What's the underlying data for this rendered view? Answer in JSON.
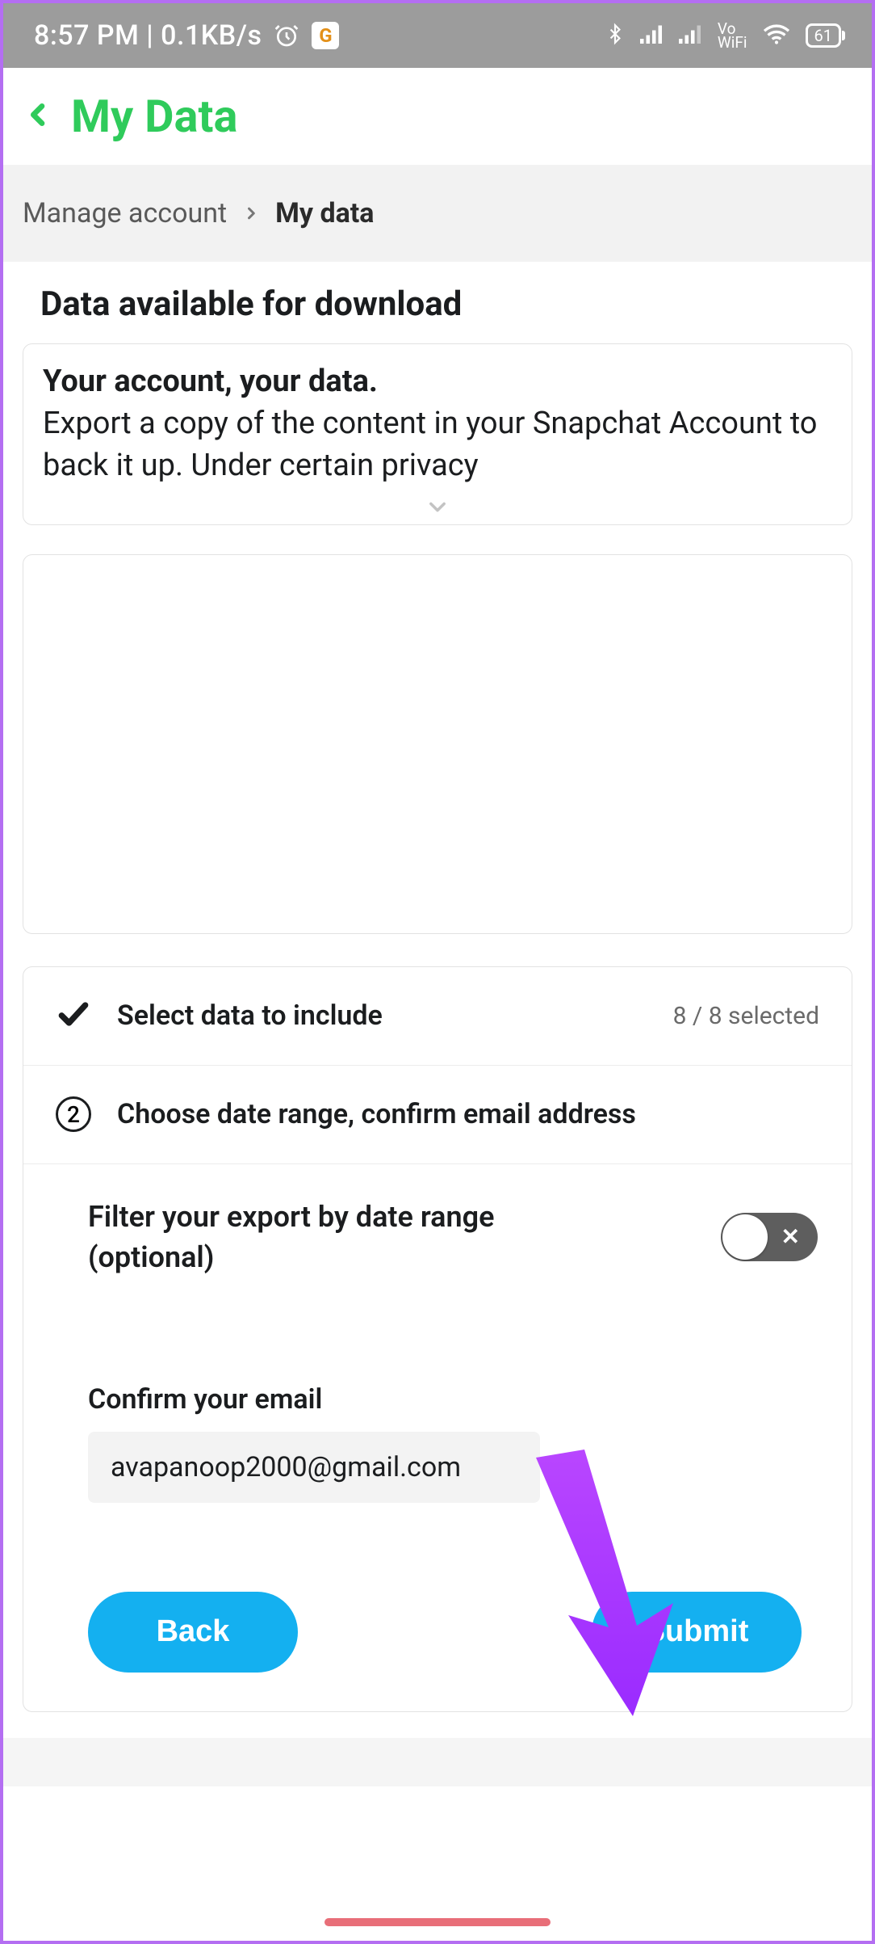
{
  "status": {
    "time_speed": "8:57 PM | 0.1KB/s",
    "vo_wifi_top": "Vo",
    "vo_wifi_bot": "WiFi",
    "battery": "61"
  },
  "title": "My Data",
  "breadcrumb": {
    "a": "Manage account",
    "b": "My data"
  },
  "section_heading": "Data available for download",
  "intro": {
    "title": "Your account, your data.",
    "body": "Export a copy of the content in your Snapchat Account to back it up. Under certain privacy"
  },
  "step1": {
    "title": "Select data to include",
    "count": "8 / 8 selected"
  },
  "step2": {
    "num": "2",
    "title": "Choose date range, confirm email address",
    "filter_label": "Filter your export by date range (optional)",
    "email_label": "Confirm your email",
    "email_value": "avapanoop2000@gmail.com"
  },
  "buttons": {
    "back": "Back",
    "submit": "Submit"
  }
}
